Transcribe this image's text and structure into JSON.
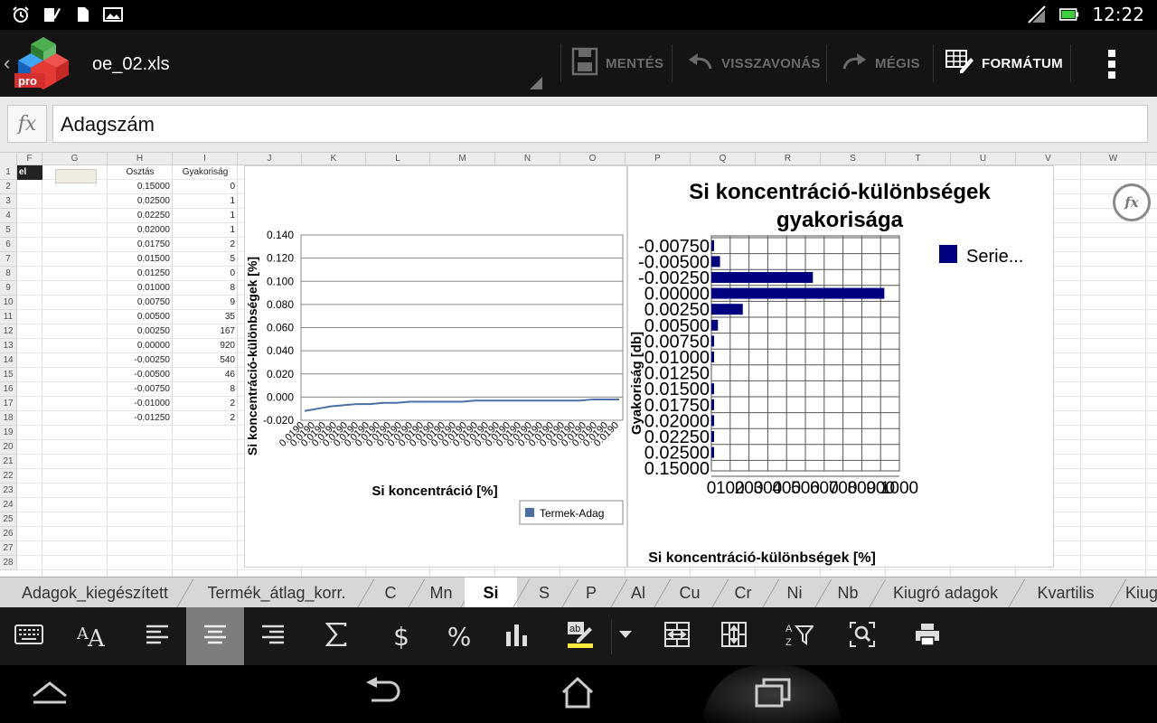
{
  "status": {
    "time": "12:22"
  },
  "app": {
    "file_name": "oe_02.xls",
    "logo_text": "pro",
    "actions": {
      "save": "MENTÉS",
      "undo": "VISSZAVONÁS",
      "redo": "MÉGIS",
      "format": "FORMÁTUM"
    }
  },
  "formula": {
    "fx_label": "fx",
    "value": "Adagszám"
  },
  "columns": [
    "F",
    "G",
    "H",
    "I",
    "J",
    "K",
    "L",
    "M",
    "N",
    "O",
    "P",
    "Q",
    "R",
    "S",
    "T",
    "U",
    "V",
    "W"
  ],
  "rows": [
    "1",
    "2",
    "3",
    "4",
    "5",
    "6",
    "7",
    "8",
    "9",
    "10",
    "11",
    "12",
    "13",
    "14",
    "15",
    "16",
    "17",
    "18",
    "19",
    "20",
    "21",
    "22",
    "23",
    "24",
    "25",
    "26",
    "27",
    "28"
  ],
  "table": {
    "f1_partial": "el",
    "headers": {
      "h": "Osztás",
      "i": "Gyakoriság"
    },
    "data": [
      {
        "h": "0.15000",
        "i": "0"
      },
      {
        "h": "0.02500",
        "i": "1"
      },
      {
        "h": "0.02250",
        "i": "1"
      },
      {
        "h": "0.02000",
        "i": "1"
      },
      {
        "h": "0.01750",
        "i": "2"
      },
      {
        "h": "0.01500",
        "i": "5"
      },
      {
        "h": "0.01250",
        "i": "0"
      },
      {
        "h": "0.01000",
        "i": "8"
      },
      {
        "h": "0.00750",
        "i": "9"
      },
      {
        "h": "0.00500",
        "i": "35"
      },
      {
        "h": "0.00250",
        "i": "167"
      },
      {
        "h": "0.00000",
        "i": "920"
      },
      {
        "h": "-0.00250",
        "i": "540"
      },
      {
        "h": "-0.00500",
        "i": "46"
      },
      {
        "h": "-0.00750",
        "i": "8"
      },
      {
        "h": "-0.01000",
        "i": "2"
      },
      {
        "h": "-0.01250",
        "i": "2"
      }
    ]
  },
  "chart_data": [
    {
      "type": "line",
      "title": "",
      "xlabel": "Si koncentráció [%]",
      "ylabel": "Si koncentráció-különbségek [%]",
      "ylim": [
        -0.02,
        0.14
      ],
      "yticks": [
        "0.140",
        "0.120",
        "0.100",
        "0.080",
        "0.060",
        "0.040",
        "0.020",
        "0.000",
        "-0.020"
      ],
      "xtick_label_sample": "0.0190",
      "legend": "bottom-right",
      "grid": true,
      "series": [
        {
          "name": "Termek-Adag",
          "color": "#4a6fa5",
          "values": [
            -0.012,
            -0.01,
            -0.008,
            -0.007,
            -0.006,
            -0.006,
            -0.005,
            -0.005,
            -0.004,
            -0.004,
            -0.004,
            -0.004,
            -0.004,
            -0.003,
            -0.003,
            -0.003,
            -0.003,
            -0.003,
            -0.003,
            -0.003,
            -0.003,
            -0.003,
            -0.002,
            -0.002,
            -0.002
          ]
        }
      ]
    },
    {
      "type": "bar",
      "orientation": "horizontal",
      "title": "Si koncentráció-különbségek gyakorisága",
      "xlabel": "Si koncentráció-különbségek [%]",
      "ylabel": "Gyakoriság [db]",
      "xlim": [
        0,
        1000
      ],
      "xticks": [
        "0",
        "100",
        "200",
        "300",
        "400",
        "500",
        "600",
        "700",
        "800",
        "900",
        "1000"
      ],
      "legend": "top-right",
      "grid": true,
      "categories": [
        "-0.00750",
        "-0.00500",
        "-0.00250",
        "0.00000",
        "0.00250",
        "0.00500",
        "0.00750",
        "0.01000",
        "0.01250",
        "0.01500",
        "0.01750",
        "0.02000",
        "0.02250",
        "0.02500",
        "0.15000"
      ],
      "series": [
        {
          "name": "Serie...",
          "color": "#000080",
          "values": [
            8,
            46,
            540,
            920,
            167,
            35,
            9,
            8,
            0,
            5,
            2,
            1,
            1,
            1,
            0
          ]
        }
      ]
    }
  ],
  "sheets": [
    "Adagok_kiegészített",
    "Termék_átlag_korr.",
    "C",
    "Mn",
    "Si",
    "S",
    "P",
    "Al",
    "Cu",
    "Cr",
    "Ni",
    "Nb",
    "Kiugró adagok",
    "Kvartilis",
    "Kiug"
  ],
  "active_sheet": "Si",
  "fx_float": "fx"
}
